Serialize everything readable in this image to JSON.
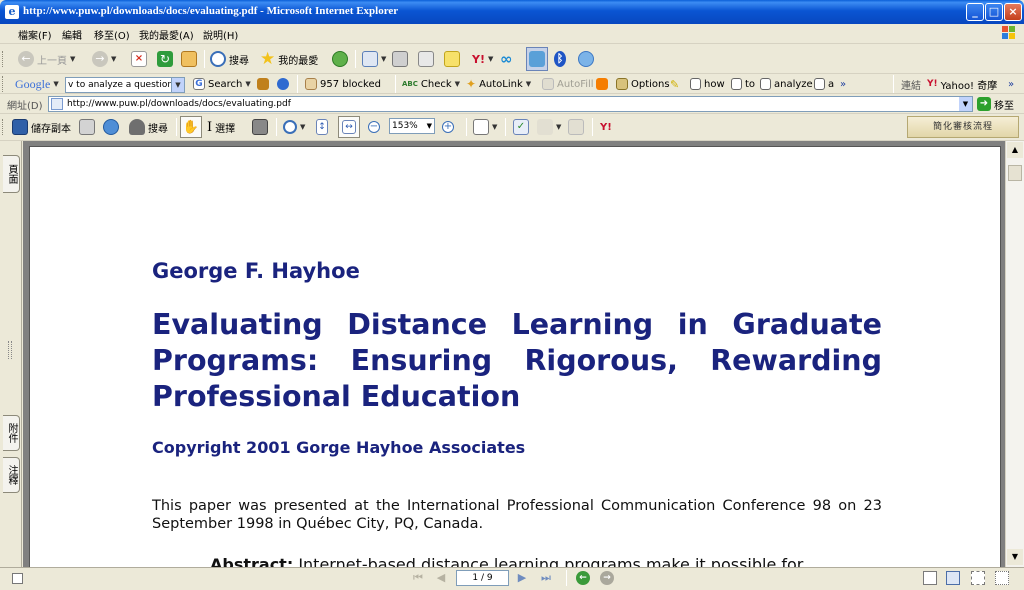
{
  "window": {
    "title": "http://www.puw.pl/downloads/docs/evaluating.pdf - Microsoft Internet Explorer",
    "minimize": "_",
    "maximize": "□",
    "close": "×"
  },
  "menu": [
    "檔案(F)",
    "編輯",
    "移至(O)",
    "我的最愛(A)",
    "說明(H)"
  ],
  "ie_toolbar": {
    "back_label": "上一頁",
    "search_label": "搜尋",
    "favorites_label": "我的最愛"
  },
  "google_toolbar": {
    "brand": "Google",
    "query": "v to analyze a questionnaire",
    "search_label": "Search",
    "blocked_label": "957 blocked",
    "check_label": "Check",
    "autolink_label": "AutoLink",
    "autofill_label": "AutoFill",
    "options_label": "Options",
    "terms": [
      "how",
      "to",
      "analyze",
      "a"
    ],
    "more": "»",
    "links_label": "連結",
    "yahoo_label": "Yahoo! 奇摩"
  },
  "address_bar": {
    "label": "網址(D)",
    "url": "http://www.puw.pl/downloads/docs/evaluating.pdf",
    "go_label": "移至"
  },
  "pdf_toolbar": {
    "save_copy_label": "儲存副本",
    "search_label": "搜尋",
    "select_label": "選擇",
    "zoom_value": "153%",
    "simplified_review_label": "簡化審核流程"
  },
  "left_tabs": {
    "pages": "頁面",
    "attachments": "附件",
    "comments": "注釋"
  },
  "document": {
    "author": "George F. Hayhoe",
    "title": "Evaluating Distance Learning in Graduate Programs: Ensuring Rigorous, Rewarding Professional Education",
    "copyright": "Copyright 2001 Gorge Hayhoe Associates",
    "presented": "This paper was presented at the International Professional Communication Conference 98 on 23 September 1998 in Québec City, PQ, Canada.",
    "abstract_label": "Abstract:",
    "abstract_text": " Internet-based distance learning programs make it possible for"
  },
  "statusbar": {
    "page_indicator": "1 / 9"
  },
  "colors": {
    "title_bar": "#0a55d3",
    "document_heading": "#1a237e",
    "chrome": "#ece9d8"
  }
}
